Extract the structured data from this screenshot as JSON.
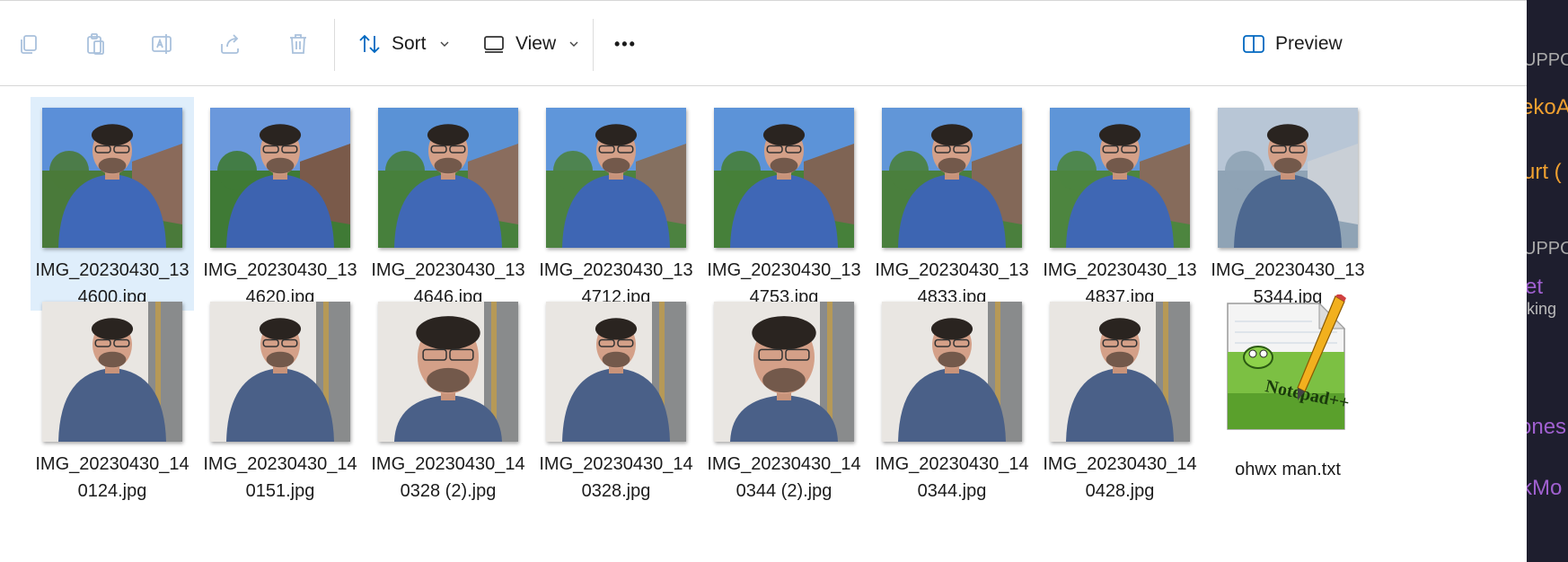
{
  "toolbar": {
    "sort_label": "Sort",
    "view_label": "View",
    "more_label": "•••",
    "preview_label": "Preview"
  },
  "files": [
    {
      "name": "IMG_20230430_134600.jpg",
      "selected": true
    },
    {
      "name": "IMG_20230430_134620.jpg"
    },
    {
      "name": "IMG_20230430_134646.jpg"
    },
    {
      "name": "IMG_20230430_134712.jpg"
    },
    {
      "name": "IMG_20230430_134753.jpg"
    },
    {
      "name": "IMG_20230430_134833.jpg"
    },
    {
      "name": "IMG_20230430_134837.jpg"
    },
    {
      "name": "IMG_20230430_135344.jpg"
    },
    {
      "name": "IMG_20230430_140124.jpg"
    },
    {
      "name": "IMG_20230430_140151.jpg"
    },
    {
      "name": "IMG_20230430_140328 (2).jpg"
    },
    {
      "name": "IMG_20230430_140328.jpg"
    },
    {
      "name": "IMG_20230430_140344 (2).jpg"
    },
    {
      "name": "IMG_20230430_140344.jpg"
    },
    {
      "name": "IMG_20230430_140428.jpg"
    },
    {
      "name": "ohwx man.txt"
    }
  ],
  "side_panel_fragments": {
    "line1": "UPPO",
    "line2": "ekoA",
    "line3": "urt (",
    "line4": "UPPO",
    "line5": "et",
    "line6": "rking",
    "line7": "ones",
    "line8": "kMo"
  },
  "colors": {
    "selection": "#dfeefb",
    "accent": "#0067c0",
    "side_bg": "#1e1e2e",
    "side_orange": "#f0a030",
    "side_purple": "#a060d0"
  }
}
